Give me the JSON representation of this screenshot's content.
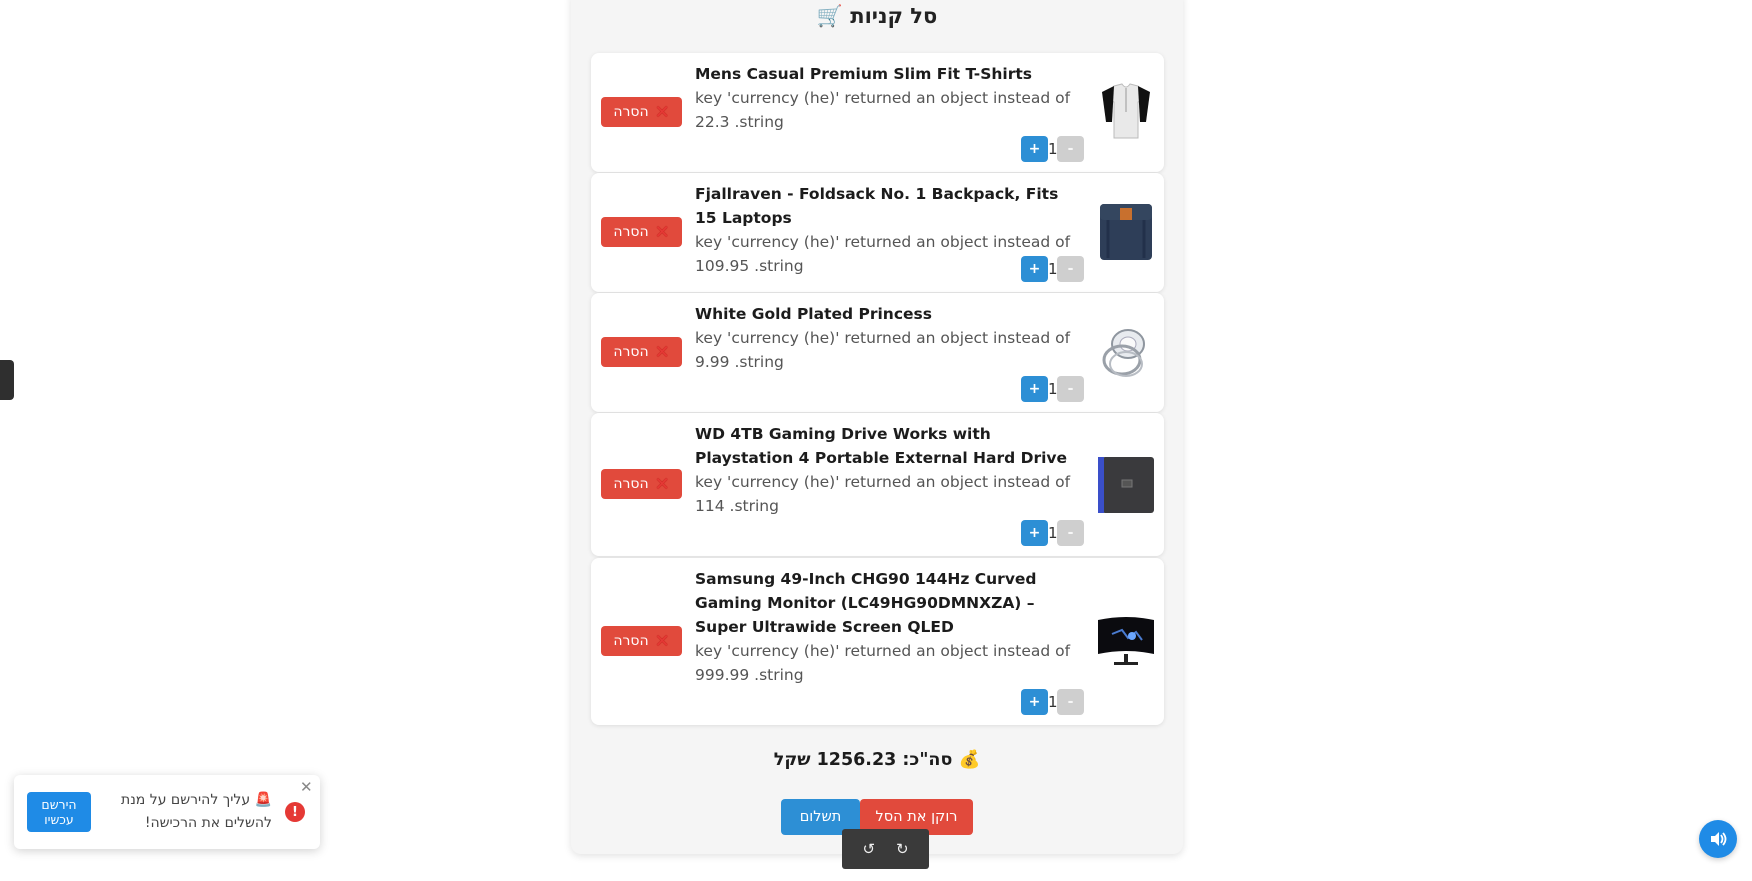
{
  "cart": {
    "title": "סל קניות 🛒",
    "items": [
      {
        "name": "Mens Casual Premium Slim Fit T-Shirts",
        "price_text": "key 'currency (he)' returned an object instead of 22.3 .string",
        "quantity": "1",
        "remove_label": "הסרה",
        "image_icon": "tshirt-image"
      },
      {
        "name": "Fjallraven - Foldsack No. 1 Backpack, Fits 15 Laptops",
        "price_text": "key 'currency (he)' returned an object instead of 109.95 .string",
        "quantity": "1",
        "remove_label": "הסרה",
        "image_icon": "backpack-image"
      },
      {
        "name": "White Gold Plated Princess",
        "price_text": "key 'currency (he)' returned an object instead of 9.99 .string",
        "quantity": "1",
        "remove_label": "הסרה",
        "image_icon": "ring-image"
      },
      {
        "name": "WD 4TB Gaming Drive Works with Playstation 4 Portable External Hard Drive",
        "price_text": "key 'currency (he)' returned an object instead of 114 .string",
        "quantity": "1",
        "remove_label": "הסרה",
        "image_icon": "hard-drive-image"
      },
      {
        "name": "Samsung 49-Inch CHG90 144Hz Curved Gaming Monitor (LC49HG90DMNXZA) – Super Ultrawide Screen QLED",
        "price_text": "key 'currency (he)' returned an object instead of 999.99 .string",
        "quantity": "1",
        "remove_label": "הסרה",
        "image_icon": "monitor-image"
      }
    ],
    "plus_label": "+",
    "minus_label": "-",
    "total_text": "💰 סה\"כ: 1256.23 שקל",
    "clear_label": "רוקן את הסל",
    "pay_label": "תשלום"
  },
  "toast": {
    "message": "🚨 עליך להירשם על מנת להשלים את הרכישה!",
    "register_label": "הירשם עכשיו",
    "alert_symbol": "!",
    "close_symbol": "✕"
  },
  "undo_bar": {
    "undo_icon": "↺",
    "redo_icon": "↻"
  },
  "colors": {
    "accent_blue": "#2d8fd5",
    "danger_red": "#e14a3c",
    "panel_bg": "#f5f5f5"
  }
}
